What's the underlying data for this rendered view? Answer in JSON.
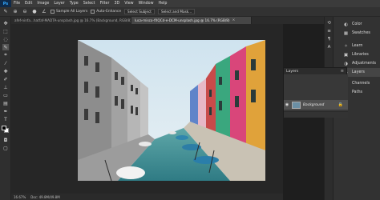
{
  "app": {
    "logo": "Ps"
  },
  "menu": [
    "File",
    "Edit",
    "Image",
    "Layer",
    "Type",
    "Select",
    "Filter",
    "3D",
    "View",
    "Window",
    "Help"
  ],
  "options": {
    "sample_all_layers": "Sample All Layers",
    "auto_enhance": "Auto-Enhance",
    "select_subject": "Select Subject",
    "select_and_mask": "Select and Mask..."
  },
  "tabs": [
    {
      "label": "afef-ninfa...hatfaf-MADTA-unsplash.jpg @ 16.7% (Background, RGB/8)",
      "active": false
    },
    {
      "label": "luca-misco-fXQCd-e-DCM-unsplash.jpg @ 16.7% (RGB/8)",
      "active": true
    }
  ],
  "status": {
    "zoom": "16.67%",
    "doc": "Doc: 49.8M/49.8M"
  },
  "panels": {
    "items": [
      {
        "label": "Color",
        "icon": "color-wheel-icon"
      },
      {
        "label": "Swatches",
        "icon": "swatches-grid-icon"
      },
      {
        "label": "Learn",
        "icon": "lightbulb-icon"
      },
      {
        "label": "Libraries",
        "icon": "libraries-icon"
      },
      {
        "label": "Adjustments",
        "icon": "adjustments-icon"
      },
      {
        "label": "Layers",
        "icon": "layers-stack-icon",
        "active": true
      },
      {
        "label": "Channels",
        "icon": "channels-icon"
      },
      {
        "label": "Paths",
        "icon": "paths-icon"
      }
    ]
  },
  "layers_panel": {
    "title": "Layers",
    "layer_name": "Background"
  },
  "colors": {
    "accent": "#31a8ff",
    "canvas_bg": "#262626",
    "panel_bg": "#323232"
  }
}
